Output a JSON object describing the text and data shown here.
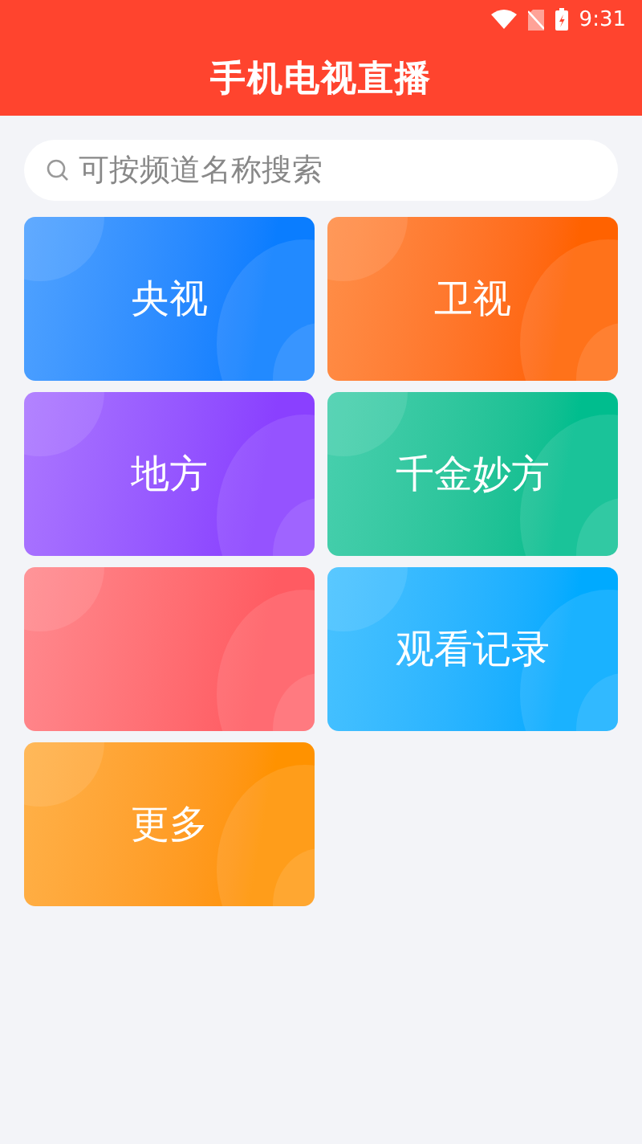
{
  "status_bar": {
    "time": "9:31"
  },
  "header": {
    "title": "手机电视直播"
  },
  "search": {
    "placeholder": "可按频道名称搜索"
  },
  "tiles": [
    {
      "label": "央视",
      "color": "#0a7dff"
    },
    {
      "label": "卫视",
      "color": "#ff6200"
    },
    {
      "label": "地方",
      "color": "#8a40ff"
    },
    {
      "label": "千金妙方",
      "color": "#00bd8e"
    },
    {
      "color": "#ff5b62"
    },
    {
      "label": "观看记录",
      "color": "#00aaff"
    },
    {
      "label": "更多",
      "color": "#ff9200"
    }
  ]
}
